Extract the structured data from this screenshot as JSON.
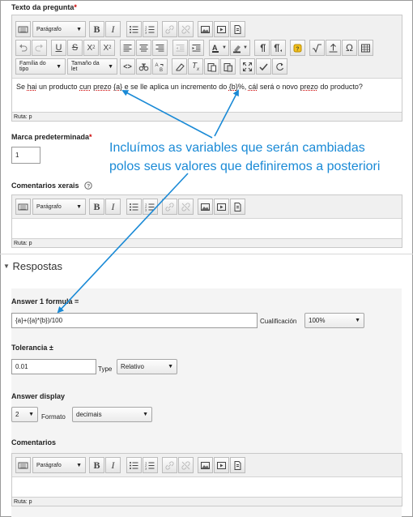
{
  "question_text": {
    "label": "Texto da pregunta",
    "required": "*",
    "toolbar_row1": {
      "paragraph_select": "Parágrafo",
      "bold": "B",
      "italic": "I",
      "underline": "U",
      "strike": "S",
      "subscript": "X",
      "subscript_mark": "2",
      "superscript": "X",
      "superscript_mark": "2"
    },
    "toolbar_row2": {
      "font_family_select": "Família do tipo",
      "font_size_select": "Tamaño da let"
    },
    "content": {
      "p1": "Se ",
      "w_hai": "hai",
      "p2": " un producto ",
      "w_cun": "cun",
      "p3": " ",
      "w_prezo": "prezo",
      "p4": " ",
      "w_a": "{a}",
      "p5": " e se lle aplica un incremento do ",
      "w_b": "{b}",
      "p6": "%, ",
      "w_cal": "cál",
      "p7": " será o novo ",
      "w_prezo2": "prezo",
      "p8": " do producto?"
    },
    "path": "Ruta: p"
  },
  "default_mark": {
    "label": "Marca predeterminada",
    "required": "*",
    "value": "1"
  },
  "general_feedback": {
    "label": "Comentarios xerais",
    "help_icon": "help-icon",
    "paragraph_select": "Parágrafo",
    "path": "Ruta: p"
  },
  "answers": {
    "heading": "Respostas",
    "formula_label": "Answer 1 formula =",
    "formula_value": "{a}+({a}*{b})/100",
    "grade_label": "Cualificación",
    "grade_value": "100%",
    "tolerance_label": "Tolerancia ±",
    "tolerance_value": "0.01",
    "type_label": "Type",
    "type_value": "Relativo",
    "display_label": "Answer display",
    "display_value": "2",
    "format_label": "Formato",
    "format_value": "decimais",
    "feedback_label": "Comentarios",
    "paragraph_select": "Parágrafo",
    "path": "Ruta: p"
  },
  "annotation": {
    "line1": "Incluímos as variables que serán cambiadas",
    "line2": "polos seus valores que definiremos a posteriori"
  },
  "colors": {
    "annotation": "#1a8ad6",
    "required": "#cc0000"
  }
}
